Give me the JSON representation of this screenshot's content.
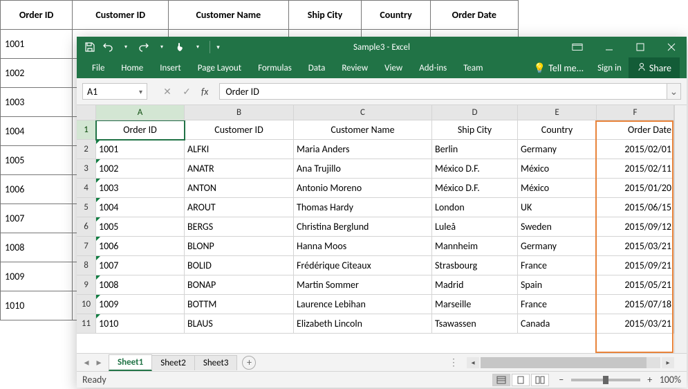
{
  "bg_table": {
    "headers": [
      "Order ID",
      "Customer ID",
      "Customer Name",
      "Ship City",
      "Country",
      "Order Date"
    ],
    "ids": [
      "1001",
      "1002",
      "1003",
      "1004",
      "1005",
      "1006",
      "1007",
      "1008",
      "1009",
      "1010"
    ]
  },
  "window": {
    "title": "Sample3 - Excel"
  },
  "ribbon": {
    "tabs": [
      "File",
      "Home",
      "Insert",
      "Page Layout",
      "Formulas",
      "Data",
      "Review",
      "View",
      "Add-ins",
      "Team"
    ],
    "tell_me": "Tell me...",
    "sign_in": "Sign in",
    "share": "Share"
  },
  "namebox": "A1",
  "formula_value": "Order ID",
  "columns": [
    "A",
    "B",
    "C",
    "D",
    "E",
    "F"
  ],
  "sheet_headers": [
    "Order ID",
    "Customer ID",
    "Customer Name",
    "Ship City",
    "Country",
    "Order Date"
  ],
  "rows": [
    {
      "n": "2",
      "a": "1001",
      "b": "ALFKI",
      "c": "Maria Anders",
      "d": "Berlin",
      "e": "Germany",
      "f": "2015/02/01"
    },
    {
      "n": "3",
      "a": "1002",
      "b": "ANATR",
      "c": "Ana Trujillo",
      "d": "México D.F.",
      "e": "México",
      "f": "2015/02/11"
    },
    {
      "n": "4",
      "a": "1003",
      "b": "ANTON",
      "c": "Antonio Moreno",
      "d": "México D.F.",
      "e": "México",
      "f": "2015/01/20"
    },
    {
      "n": "5",
      "a": "1004",
      "b": "AROUT",
      "c": "Thomas Hardy",
      "d": "London",
      "e": "UK",
      "f": "2015/06/15"
    },
    {
      "n": "6",
      "a": "1005",
      "b": "BERGS",
      "c": "Christina Berglund",
      "d": "Luleå",
      "e": "Sweden",
      "f": "2015/09/12"
    },
    {
      "n": "7",
      "a": "1006",
      "b": "BLONP",
      "c": "Hanna Moos",
      "d": "Mannheim",
      "e": "Germany",
      "f": "2015/03/21"
    },
    {
      "n": "8",
      "a": "1007",
      "b": "BOLID",
      "c": "Frédérique Citeaux",
      "d": "Strasbourg",
      "e": "France",
      "f": "2015/09/21"
    },
    {
      "n": "9",
      "a": "1008",
      "b": "BONAP",
      "c": "Martin Sommer",
      "d": "Madrid",
      "e": "Spain",
      "f": "2015/05/21"
    },
    {
      "n": "10",
      "a": "1009",
      "b": "BOTTM",
      "c": "Laurence Lebihan",
      "d": "Marseille",
      "e": "France",
      "f": "2015/07/18"
    },
    {
      "n": "11",
      "a": "1010",
      "b": "BLAUS",
      "c": "Elizabeth Lincoln",
      "d": "Tsawassen",
      "e": "Canada",
      "f": "2015/03/21"
    }
  ],
  "sheets": {
    "active": "Sheet1",
    "others": [
      "Sheet2",
      "Sheet3"
    ]
  },
  "status": {
    "ready": "Ready",
    "zoom": "100%"
  }
}
